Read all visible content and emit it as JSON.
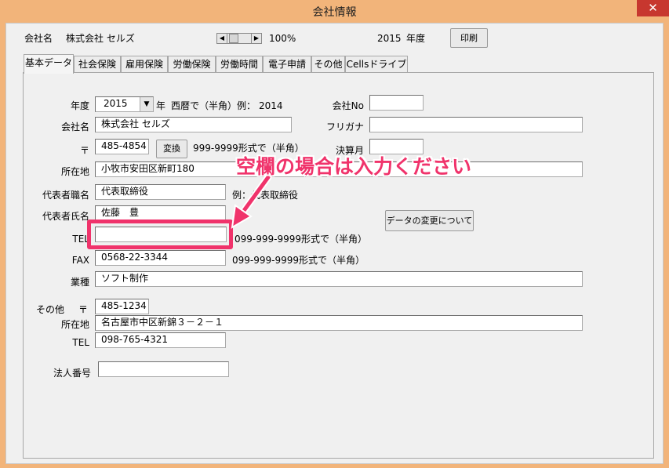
{
  "window": {
    "title": "会社情報",
    "close_icon": "✕"
  },
  "header": {
    "company_label": "会社名",
    "company_value": "株式会社 セルズ",
    "zoom": "100%",
    "year_value": "2015",
    "year_label": "年度",
    "print_button": "印刷"
  },
  "tabs": [
    "基本データ",
    "社会保険",
    "雇用保険",
    "労働保険",
    "労働時間",
    "電子申請",
    "その他",
    "Cellsドライブ"
  ],
  "form": {
    "year_label": "年度",
    "year_value": "2015",
    "year_suffix": "年",
    "year_hint": "西暦で（半角）例：",
    "year_example": "2014",
    "company_no_label": "会社No",
    "company_no_value": "",
    "company_name_label": "会社名",
    "company_name_value": "株式会社 セルズ",
    "furigana_label": "フリガナ",
    "furigana_value": "",
    "postal_label": "〒",
    "postal_value": "485-4854",
    "convert_button": "変換",
    "postal_hint": "999-9999形式で（半角）",
    "settlement_label": "決算月",
    "settlement_value": "",
    "address_label": "所在地",
    "address_value": "小牧市安田区新町180",
    "rep_title_label": "代表者職名",
    "rep_title_value": "代表取締役",
    "rep_title_hint": "例：代表取締役",
    "rep_name_label": "代表者氏名",
    "rep_name_value": "佐藤　豊",
    "data_change_button": "データの変更について",
    "tel_label": "TEL",
    "tel_value": "",
    "tel_hint": "099-999-9999形式で（半角）",
    "fax_label": "FAX",
    "fax_value": "0568-22-3344",
    "fax_hint": "099-999-9999形式で（半角）",
    "industry_label": "業種",
    "industry_value": "ソフト制作",
    "other_label": "その他",
    "other_postal_label": "〒",
    "other_postal_value": "485-1234",
    "other_address_label": "所在地",
    "other_address_value": "名古屋市中区新錦３－２－１",
    "other_tel_label": "TEL",
    "other_tel_value": "098-765-4321",
    "corp_number_label": "法人番号",
    "corp_number_value": ""
  },
  "annotation": {
    "text": "空欄の場合は入力ください",
    "color": "#f0336b"
  }
}
